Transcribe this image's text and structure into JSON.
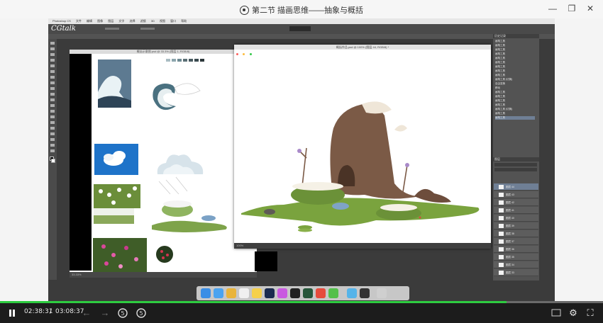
{
  "window": {
    "title": "第二节 描画思维——抽象与概括",
    "minimize_glyph": "—",
    "restore_glyph": "❐",
    "close_glyph": "✕"
  },
  "photoshop": {
    "brand": "CGtalk",
    "menu": [
      "Photoshop CS",
      "文件",
      "编辑",
      "图像",
      "图层",
      "文字",
      "选择",
      "滤镜",
      "3D",
      "视图",
      "窗口",
      "帮助"
    ],
    "doc_left_title": "概括示意图.psd @ 33.3% (图层 1, RGB/8)",
    "doc_left_status": "33.33%",
    "doc_right_title": "概括作品.psd @ 100% (图层 44, RGB/8) *",
    "doc_right_status": "100%",
    "history_header": "历史记录",
    "history_items": [
      "画笔工具",
      "画笔工具",
      "画笔工具",
      "画笔工具",
      "画笔工具",
      "画笔工具",
      "画笔工具",
      "画笔工具",
      "画笔工具",
      "画笔工具 (切换)",
      "自由变换",
      "移动",
      "画笔工具",
      "画笔工具",
      "画笔工具",
      "画笔工具",
      "画笔工具 (切换)",
      "画笔工具",
      "画笔工具"
    ],
    "layers_header": "图层",
    "layers": [
      "图层 44",
      "图层 43",
      "图层 42",
      "图层 41",
      "图层 40",
      "图层 39",
      "图层 38",
      "图层 37",
      "图层 36",
      "图层 35",
      "图层 34",
      "图层 33",
      "图层 32",
      "图层 31"
    ]
  },
  "player": {
    "current_time": "02:38:31",
    "separator": "/",
    "total_time": "03:08:37",
    "progress_percent": 84
  },
  "colors": {
    "progress": "#2ecc40",
    "controls_bg": "#1c1c1c",
    "ps_bg": "#3b3b3b"
  }
}
